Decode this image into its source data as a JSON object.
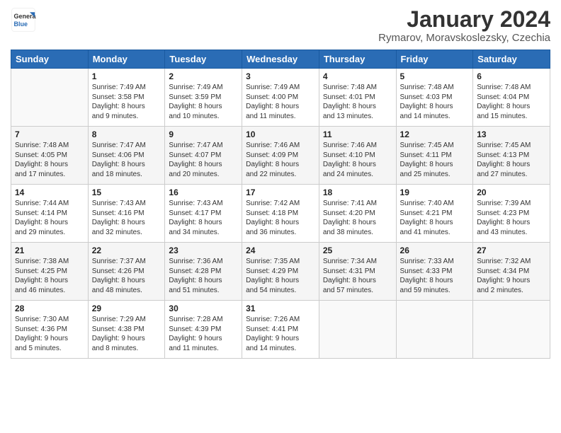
{
  "logo": {
    "general": "General",
    "blue": "Blue"
  },
  "title": "January 2024",
  "location": "Rymarov, Moravskoslezsky, Czechia",
  "days_header": [
    "Sunday",
    "Monday",
    "Tuesday",
    "Wednesday",
    "Thursday",
    "Friday",
    "Saturday"
  ],
  "weeks": [
    [
      {
        "day": "",
        "info": ""
      },
      {
        "day": "1",
        "info": "Sunrise: 7:49 AM\nSunset: 3:58 PM\nDaylight: 8 hours\nand 9 minutes."
      },
      {
        "day": "2",
        "info": "Sunrise: 7:49 AM\nSunset: 3:59 PM\nDaylight: 8 hours\nand 10 minutes."
      },
      {
        "day": "3",
        "info": "Sunrise: 7:49 AM\nSunset: 4:00 PM\nDaylight: 8 hours\nand 11 minutes."
      },
      {
        "day": "4",
        "info": "Sunrise: 7:48 AM\nSunset: 4:01 PM\nDaylight: 8 hours\nand 13 minutes."
      },
      {
        "day": "5",
        "info": "Sunrise: 7:48 AM\nSunset: 4:03 PM\nDaylight: 8 hours\nand 14 minutes."
      },
      {
        "day": "6",
        "info": "Sunrise: 7:48 AM\nSunset: 4:04 PM\nDaylight: 8 hours\nand 15 minutes."
      }
    ],
    [
      {
        "day": "7",
        "info": "Sunrise: 7:48 AM\nSunset: 4:05 PM\nDaylight: 8 hours\nand 17 minutes."
      },
      {
        "day": "8",
        "info": "Sunrise: 7:47 AM\nSunset: 4:06 PM\nDaylight: 8 hours\nand 18 minutes."
      },
      {
        "day": "9",
        "info": "Sunrise: 7:47 AM\nSunset: 4:07 PM\nDaylight: 8 hours\nand 20 minutes."
      },
      {
        "day": "10",
        "info": "Sunrise: 7:46 AM\nSunset: 4:09 PM\nDaylight: 8 hours\nand 22 minutes."
      },
      {
        "day": "11",
        "info": "Sunrise: 7:46 AM\nSunset: 4:10 PM\nDaylight: 8 hours\nand 24 minutes."
      },
      {
        "day": "12",
        "info": "Sunrise: 7:45 AM\nSunset: 4:11 PM\nDaylight: 8 hours\nand 25 minutes."
      },
      {
        "day": "13",
        "info": "Sunrise: 7:45 AM\nSunset: 4:13 PM\nDaylight: 8 hours\nand 27 minutes."
      }
    ],
    [
      {
        "day": "14",
        "info": "Sunrise: 7:44 AM\nSunset: 4:14 PM\nDaylight: 8 hours\nand 29 minutes."
      },
      {
        "day": "15",
        "info": "Sunrise: 7:43 AM\nSunset: 4:16 PM\nDaylight: 8 hours\nand 32 minutes."
      },
      {
        "day": "16",
        "info": "Sunrise: 7:43 AM\nSunset: 4:17 PM\nDaylight: 8 hours\nand 34 minutes."
      },
      {
        "day": "17",
        "info": "Sunrise: 7:42 AM\nSunset: 4:18 PM\nDaylight: 8 hours\nand 36 minutes."
      },
      {
        "day": "18",
        "info": "Sunrise: 7:41 AM\nSunset: 4:20 PM\nDaylight: 8 hours\nand 38 minutes."
      },
      {
        "day": "19",
        "info": "Sunrise: 7:40 AM\nSunset: 4:21 PM\nDaylight: 8 hours\nand 41 minutes."
      },
      {
        "day": "20",
        "info": "Sunrise: 7:39 AM\nSunset: 4:23 PM\nDaylight: 8 hours\nand 43 minutes."
      }
    ],
    [
      {
        "day": "21",
        "info": "Sunrise: 7:38 AM\nSunset: 4:25 PM\nDaylight: 8 hours\nand 46 minutes."
      },
      {
        "day": "22",
        "info": "Sunrise: 7:37 AM\nSunset: 4:26 PM\nDaylight: 8 hours\nand 48 minutes."
      },
      {
        "day": "23",
        "info": "Sunrise: 7:36 AM\nSunset: 4:28 PM\nDaylight: 8 hours\nand 51 minutes."
      },
      {
        "day": "24",
        "info": "Sunrise: 7:35 AM\nSunset: 4:29 PM\nDaylight: 8 hours\nand 54 minutes."
      },
      {
        "day": "25",
        "info": "Sunrise: 7:34 AM\nSunset: 4:31 PM\nDaylight: 8 hours\nand 57 minutes."
      },
      {
        "day": "26",
        "info": "Sunrise: 7:33 AM\nSunset: 4:33 PM\nDaylight: 8 hours\nand 59 minutes."
      },
      {
        "day": "27",
        "info": "Sunrise: 7:32 AM\nSunset: 4:34 PM\nDaylight: 9 hours\nand 2 minutes."
      }
    ],
    [
      {
        "day": "28",
        "info": "Sunrise: 7:30 AM\nSunset: 4:36 PM\nDaylight: 9 hours\nand 5 minutes."
      },
      {
        "day": "29",
        "info": "Sunrise: 7:29 AM\nSunset: 4:38 PM\nDaylight: 9 hours\nand 8 minutes."
      },
      {
        "day": "30",
        "info": "Sunrise: 7:28 AM\nSunset: 4:39 PM\nDaylight: 9 hours\nand 11 minutes."
      },
      {
        "day": "31",
        "info": "Sunrise: 7:26 AM\nSunset: 4:41 PM\nDaylight: 9 hours\nand 14 minutes."
      },
      {
        "day": "",
        "info": ""
      },
      {
        "day": "",
        "info": ""
      },
      {
        "day": "",
        "info": ""
      }
    ]
  ]
}
